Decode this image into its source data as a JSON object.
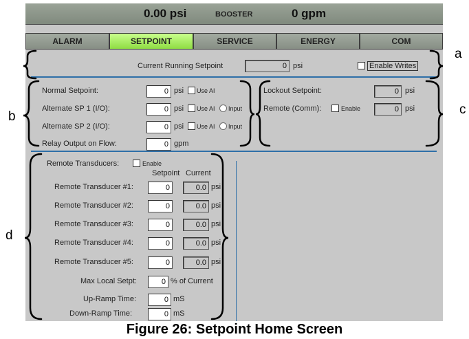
{
  "header": {
    "pressure": "0.00 psi",
    "mode": "BOOSTER",
    "flow": "0 gpm"
  },
  "tabs": [
    {
      "label": "ALARM"
    },
    {
      "label": "SETPOINT",
      "active": true
    },
    {
      "label": "SERVICE"
    },
    {
      "label": "ENERGY"
    },
    {
      "label": "COM"
    }
  ],
  "section_a": {
    "running_label": "Current Running Setpoint",
    "running_value": "0",
    "running_unit": "psi",
    "enable_writes": "Enable Writes"
  },
  "section_b": {
    "normal_label": "Normal Setpoint:",
    "normal_value": "0",
    "alt1_label": "Alternate SP 1 (I/O):",
    "alt1_value": "0",
    "alt2_label": "Alternate SP 2 (I/O):",
    "alt2_value": "0",
    "relay_label": "Relay Output on Flow:",
    "relay_value": "0",
    "psi": "psi",
    "gpm": "gpm",
    "use_ai": "Use AI",
    "input": "Input"
  },
  "section_c": {
    "lockout_label": "Lockout Setpoint:",
    "lockout_value": "0",
    "remote_label": "Remote (Comm):",
    "enable": "Enable",
    "remote_value": "0",
    "psi": "psi"
  },
  "section_d": {
    "remote_label": "Remote Transducers:",
    "enable": "Enable",
    "col_setpoint": "Setpoint",
    "col_current": "Current",
    "transducers": [
      {
        "label": "Remote Transducer #1:",
        "setpoint": "0",
        "current": "0.0",
        "unit": "psi"
      },
      {
        "label": "Remote Transducer #2:",
        "setpoint": "0",
        "current": "0.0",
        "unit": "psi"
      },
      {
        "label": "Remote Transducer #3:",
        "setpoint": "0",
        "current": "0.0",
        "unit": "psi"
      },
      {
        "label": "Remote Transducer #4:",
        "setpoint": "0",
        "current": "0.0",
        "unit": "psi"
      },
      {
        "label": "Remote Transducer #5:",
        "setpoint": "0",
        "current": "0.0",
        "unit": "psi"
      }
    ],
    "max_local_label": "Max Local Setpt:",
    "max_local_value": "0",
    "max_local_unit": "% of Current",
    "up_ramp_label": "Up-Ramp Time:",
    "up_ramp_value": "0",
    "up_ramp_unit": "mS",
    "down_ramp_label": "Down-Ramp Time:",
    "down_ramp_value": "0",
    "down_ramp_unit": "mS"
  },
  "annotations": {
    "a": "a",
    "b": "b",
    "c": "c",
    "d": "d"
  },
  "caption": "Figure 26: Setpoint Home Screen"
}
